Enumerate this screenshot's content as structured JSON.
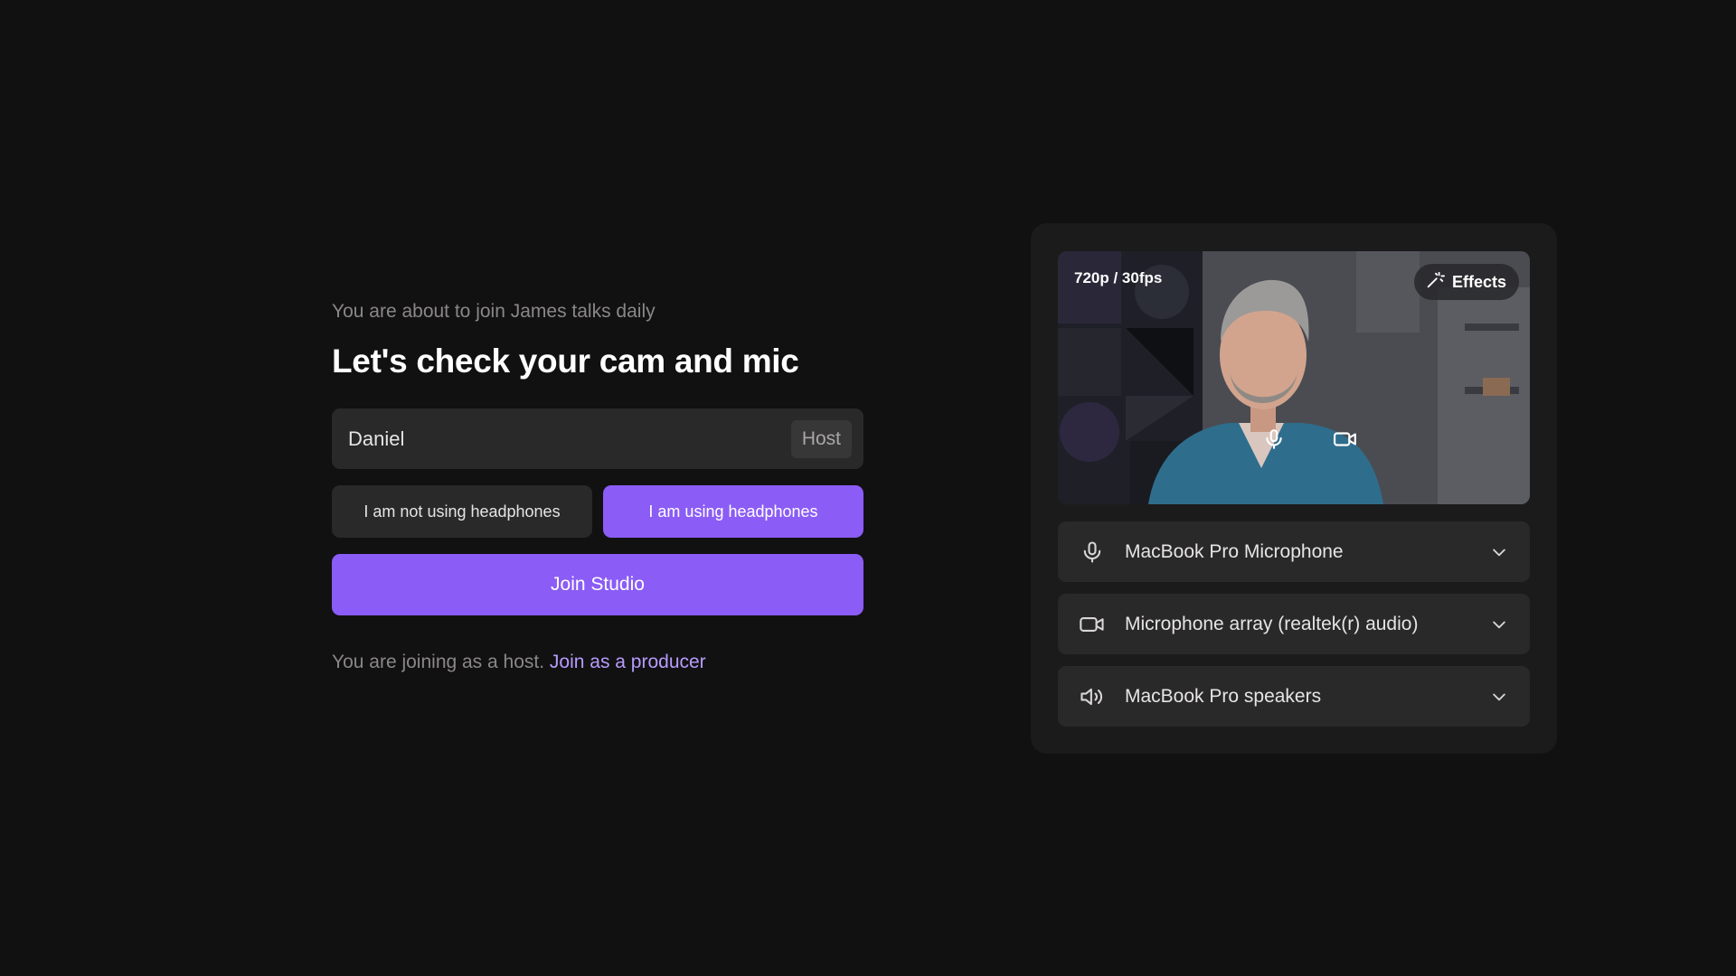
{
  "intro": {
    "subtitle": "You are about to join James talks daily",
    "title": "Let's check your cam and mic"
  },
  "name_field": {
    "value": "Daniel",
    "role_badge": "Host"
  },
  "headphones": {
    "not_using_label": "I am not using headphones",
    "using_label": "I am using headphones",
    "selected": "using"
  },
  "join_button": {
    "label": "Join Studio"
  },
  "joining_note": {
    "text": "You are joining as a host.",
    "link": "Join as a producer"
  },
  "preview": {
    "resolution": "720p / 30fps",
    "effects_label": "Effects",
    "icons": [
      "microphone-icon",
      "camera-icon"
    ]
  },
  "devices": [
    {
      "icon": "microphone-icon",
      "label": "MacBook Pro Microphone"
    },
    {
      "icon": "camera-icon",
      "label": "Microphone array (realtek(r) audio)"
    },
    {
      "icon": "speaker-icon",
      "label": "MacBook Pro speakers"
    }
  ],
  "colors": {
    "background": "#121112",
    "panel": "#1c1b1c",
    "field": "#2a292a",
    "accent": "#8b5cf6",
    "link": "#b69cff",
    "muted_text": "#8a8789"
  }
}
